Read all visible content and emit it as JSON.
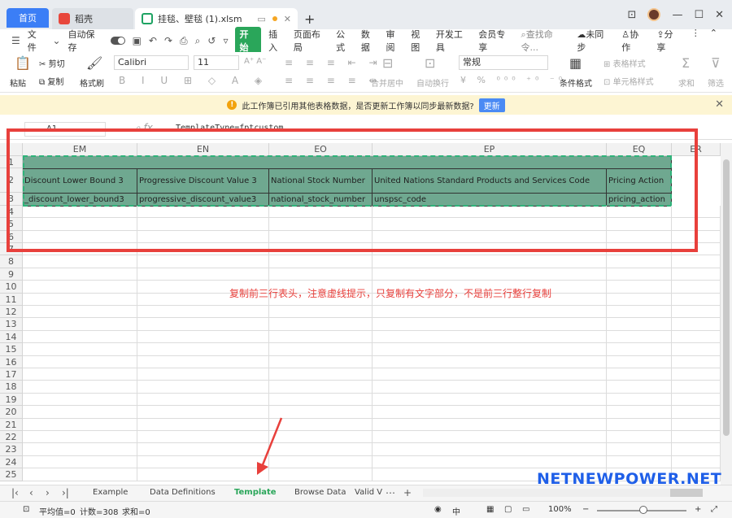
{
  "titlebar": {
    "home_tab": "首页",
    "tab2": "稻壳",
    "tab3": "挂毯、壁毯 (1).xlsm",
    "new_tab": "+"
  },
  "menubar": {
    "file": "文件",
    "autosave": "自动保存",
    "start": "开始",
    "items": [
      "插入",
      "页面布局",
      "公式",
      "数据",
      "审阅",
      "视图",
      "开发工具",
      "会员专享"
    ],
    "search": "查找命令...",
    "unsync": "未同步",
    "collab": "协作",
    "share": "分享"
  },
  "ribbon": {
    "paste": "粘贴",
    "cut": "剪切",
    "copy": "复制",
    "format_painter": "格式刷",
    "font": "Calibri",
    "size": "11",
    "merge": "合并居中",
    "wrap": "自动换行",
    "number_format": "常规",
    "cond_format": "条件格式",
    "table_style": "表格样式",
    "cell_style": "单元格样式",
    "sum": "求和",
    "filter": "筛选"
  },
  "notice": {
    "text": "此工作簿已引用其他表格数据，是否更新工作簿以同步最新数据?",
    "button": "更新"
  },
  "formula": {
    "namebox": "A1",
    "text": "TemplateType=fptcustom"
  },
  "columns": [
    "EM",
    "EN",
    "EO",
    "EP",
    "EQ",
    "ER"
  ],
  "rows": [
    "1",
    "2",
    "3",
    "4",
    "5",
    "6",
    "7",
    "8",
    "9",
    "10",
    "11",
    "12",
    "13",
    "14",
    "15",
    "16",
    "17",
    "18",
    "19",
    "20",
    "21",
    "22",
    "23",
    "24",
    "25"
  ],
  "row2": [
    "Discount Lower Bound 3",
    "Progressive Discount Value 3",
    "National Stock Number",
    "United Nations Standard Products and Services Code",
    "Pricing Action"
  ],
  "row3": [
    "_discount_lower_bound3",
    "progressive_discount_value3",
    "national_stock_number",
    "unspsc_code",
    "pricing_action"
  ],
  "annotation": "复制前三行表头，注意虚线提示，只复制有文字部分，不是前三行整行复制",
  "sheets": [
    "Example",
    "Data Definitions",
    "Template",
    "Browse Data",
    "Valid V"
  ],
  "status": {
    "avg": "平均值=0",
    "count": "计数=308",
    "sum": "求和=0",
    "zoom": "100%"
  },
  "watermark": "NETNEWPOWER.NET"
}
